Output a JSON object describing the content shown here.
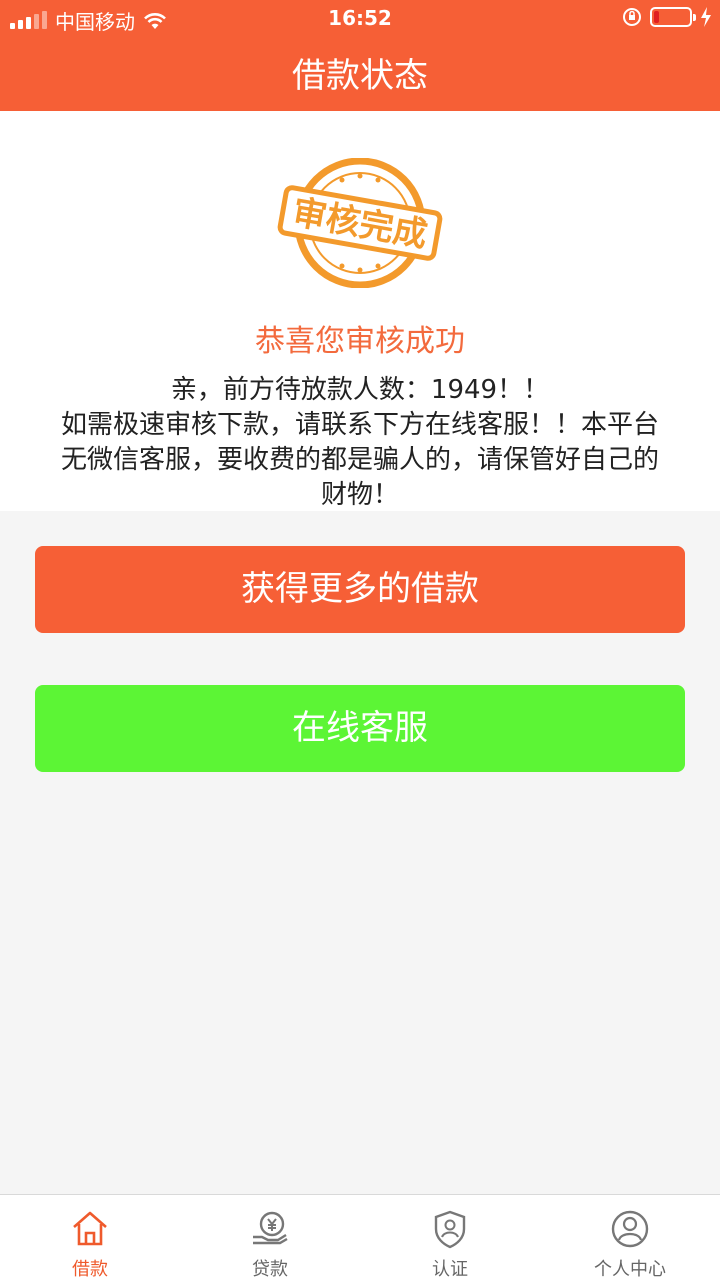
{
  "status_bar": {
    "carrier": "中国移动",
    "time": "16:52"
  },
  "header": {
    "title": "借款状态"
  },
  "stamp": {
    "text": "审核完成"
  },
  "result": {
    "congrats": "恭喜您审核成功",
    "message_lines": [
      "亲，前方待放款人数：1949！！",
      "如需极速审核下款，请联系下方在线客服！！本平台",
      "无微信客服，要收费的都是骗人的，请保管好自己的",
      "财物！"
    ]
  },
  "buttons": {
    "more_loans": "获得更多的借款",
    "online_service": "在线客服"
  },
  "tabbar": {
    "items": [
      {
        "label": "借款",
        "icon": "home-icon",
        "active": true
      },
      {
        "label": "贷款",
        "icon": "yuan-hand-icon",
        "active": false
      },
      {
        "label": "认证",
        "icon": "shield-user-icon",
        "active": false
      },
      {
        "label": "个人中心",
        "icon": "user-icon",
        "active": false
      }
    ]
  },
  "colors": {
    "primary": "#f65f36",
    "service_button": "#5cf535",
    "stamp": "#f39a2c"
  }
}
